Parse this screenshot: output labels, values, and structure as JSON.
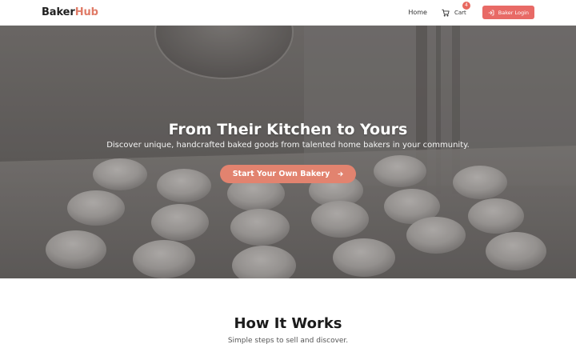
{
  "brand": {
    "part1": "Baker",
    "part2": "Hub"
  },
  "nav": {
    "home_label": "Home",
    "cart_label": "Cart",
    "cart_count": "4",
    "login_label": "Baker Login"
  },
  "hero": {
    "title": "From Their Kitchen to Yours",
    "subtitle": "Discover unique, handcrafted baked goods from talented home bakers in your community.",
    "cta_label": "Start Your Own Bakery"
  },
  "how_it_works": {
    "title": "How It Works",
    "subtitle": "Simple steps to sell and discover."
  },
  "icons": {
    "cart": "cart-icon",
    "login": "login-icon",
    "cta": "arrow-right-icon"
  },
  "colors": {
    "brand_accent": "#e07b67",
    "login_button": "#e86a66",
    "cta_button": "#e2836f",
    "badge": "#e8675e",
    "hero_overlay": "#4d4b49"
  }
}
